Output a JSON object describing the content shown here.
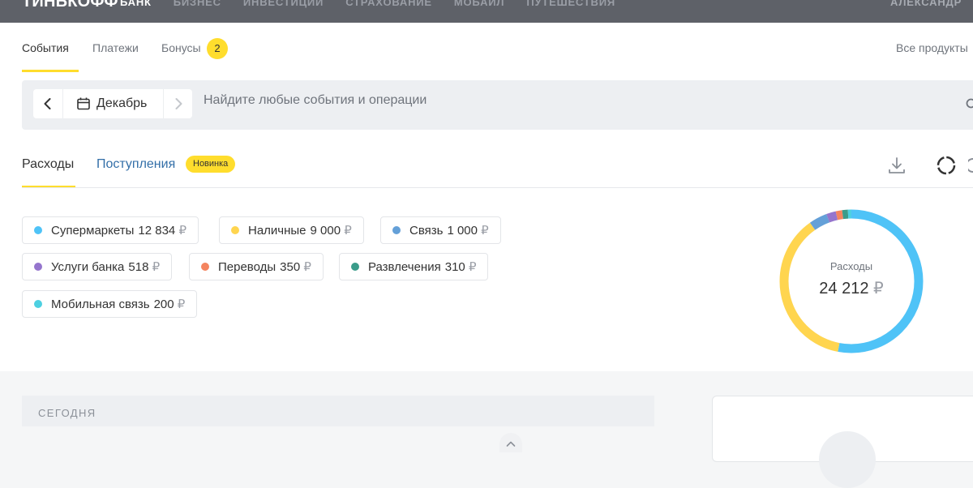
{
  "topbar": {
    "brand": "ТИНЬКОФФ",
    "nav": [
      "БАНК",
      "БИЗНЕС",
      "ИНВЕСТИЦИИ",
      "СТРАХОВАНИЕ",
      "МОБАЙЛ",
      "ПУТЕШЕСТВИЯ"
    ],
    "active": "БАНК",
    "user": "АЛЕКСАНДР"
  },
  "subnav": {
    "tabs": [
      "События",
      "Платежи",
      "Бонусы"
    ],
    "bonus_count": "2",
    "all_products": "Все продукты"
  },
  "search": {
    "month": "Декабрь",
    "placeholder": "Найдите любые события и операции"
  },
  "tabs": {
    "expenses": "Расходы",
    "income": "Поступления",
    "new_badge": "Новинка"
  },
  "currency": "₽",
  "categories": [
    {
      "name": "Супермаркеты",
      "amount": "12 834",
      "value": 12834,
      "color": "#4fc3f7"
    },
    {
      "name": "Наличные",
      "amount": "9 000",
      "value": 9000,
      "color": "#ffd54f"
    },
    {
      "name": "Связь",
      "amount": "1 000",
      "value": 1000,
      "color": "#64a0d8"
    },
    {
      "name": "Услуги банка",
      "amount": "518",
      "value": 518,
      "color": "#9575cd"
    },
    {
      "name": "Переводы",
      "amount": "350",
      "value": 350,
      "color": "#f4845f"
    },
    {
      "name": "Развлечения",
      "amount": "310",
      "value": 310,
      "color": "#3a9c8a"
    },
    {
      "name": "Мобильная связь",
      "amount": "200",
      "value": 200,
      "color": "#4dd0e1"
    }
  ],
  "summary": {
    "label": "Расходы",
    "total": "24 212"
  },
  "feed": {
    "today": "СЕГОДНЯ"
  }
}
